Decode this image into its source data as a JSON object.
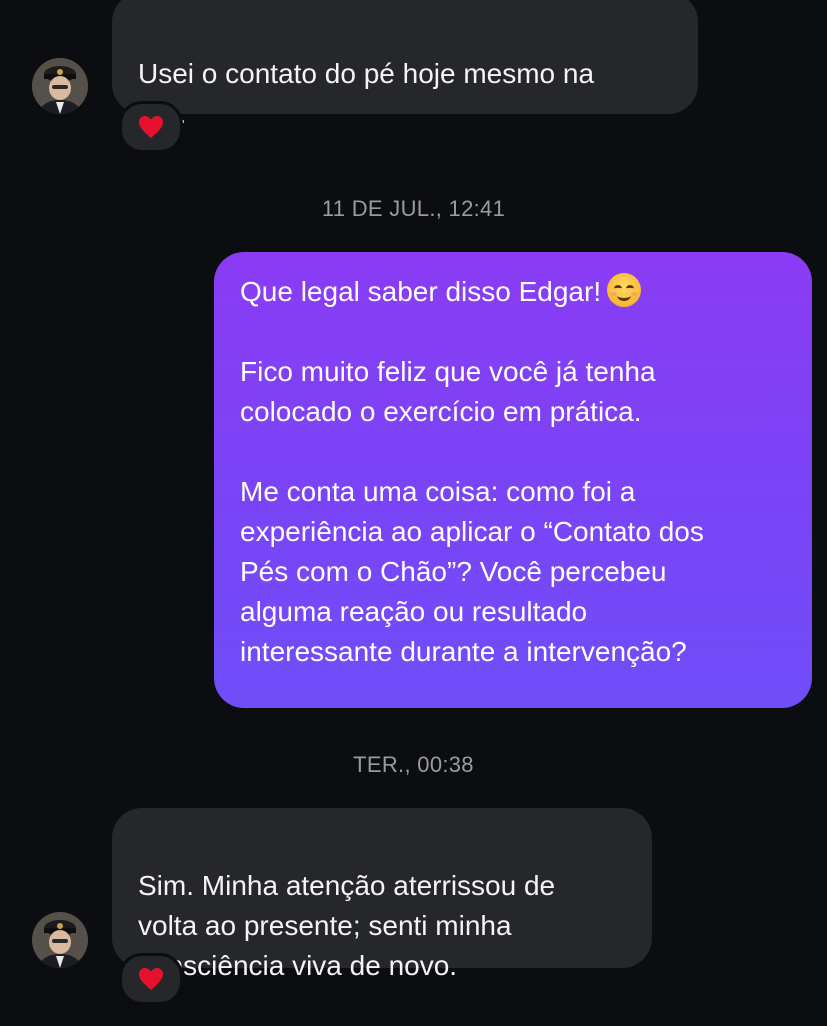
{
  "conversation": {
    "messages": [
      {
        "direction": "incoming",
        "text": "Usei o contato do pé hoje mesmo na\nrua.",
        "reaction": "heart"
      },
      {
        "direction": "outgoing",
        "paragraphs": [
          "Que legal saber disso Edgar!",
          "Fico muito feliz que você já tenha\ncolocado o exercício em prática.",
          "Me conta uma coisa: como foi a\nexperiência ao aplicar o “Contato dos\nPés com o Chão”? Você percebeu\nalguma reação ou resultado\ninteressante durante a intervenção?"
        ],
        "emoji": "smiling-face-icon"
      },
      {
        "direction": "incoming",
        "text": "Sim. Minha atenção aterrissou de\nvolta ao presente; senti minha\nconsciência viva de novo.",
        "reaction": "heart"
      }
    ],
    "timestamps": [
      "11 DE JUL., 12:41",
      "TER., 00:38"
    ]
  },
  "colors": {
    "background": "#0c0d10",
    "incoming_bubble": "#26272b",
    "outgoing_gradient_top": "#8a3cf4",
    "outgoing_gradient_bottom": "#6f4ef8",
    "timestamp_text": "#9a9ba1",
    "heart": "#e8112d"
  },
  "icons": {
    "avatar": "user-avatar",
    "reaction": "heart-icon"
  }
}
